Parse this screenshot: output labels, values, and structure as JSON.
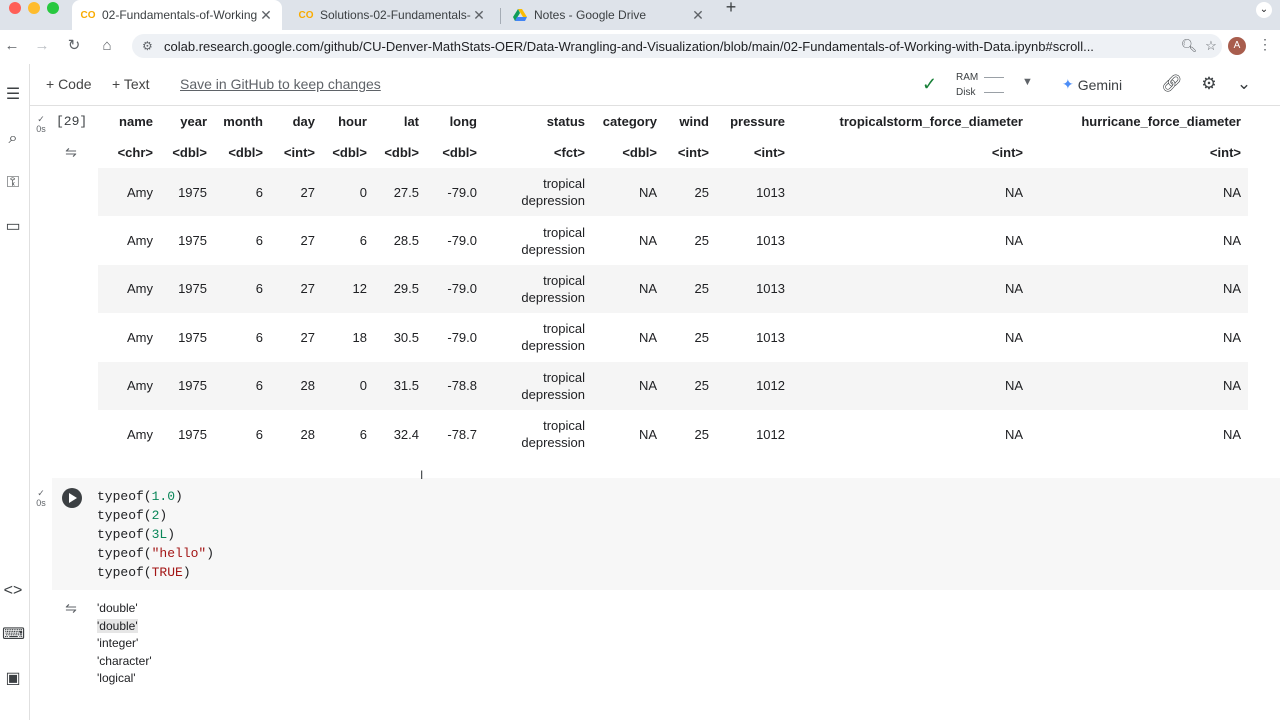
{
  "browser": {
    "tabs": [
      {
        "title": "02-Fundamentals-of-Working",
        "active": true
      },
      {
        "title": "Solutions-02-Fundamentals-",
        "active": false
      },
      {
        "title": "Notes - Google Drive",
        "active": false
      }
    ],
    "new_tab": "+",
    "url": "colab.research.google.com/github/CU-Denver-MathStats-OER/Data-Wrangling-and-Visualization/blob/main/02-Fundamentals-of-Working-with-Data.ipynb#scroll...",
    "avatar_letter": "A"
  },
  "toolbar": {
    "code_label": "+ Code",
    "text_label": "+ Text",
    "save_link": "Save in GitHub to keep changes",
    "ram_label": "RAM",
    "disk_label": "Disk",
    "gemini_label": "Gemini"
  },
  "cells": {
    "table_cell": {
      "status_time": "0s",
      "exec_count": "[29]",
      "columns": [
        "name",
        "year",
        "month",
        "day",
        "hour",
        "lat",
        "long",
        "status",
        "category",
        "wind",
        "pressure",
        "tropicalstorm_force_diameter",
        "hurricane_force_diameter"
      ],
      "types": [
        "<chr>",
        "<dbl>",
        "<dbl>",
        "<int>",
        "<dbl>",
        "<dbl>",
        "<dbl>",
        "<fct>",
        "<dbl>",
        "<int>",
        "<int>",
        "<int>",
        "<int>"
      ],
      "rows": [
        [
          "Amy",
          "1975",
          "6",
          "27",
          "0",
          "27.5",
          "-79.0",
          "tropical depression",
          "NA",
          "25",
          "1013",
          "NA",
          "NA"
        ],
        [
          "Amy",
          "1975",
          "6",
          "27",
          "6",
          "28.5",
          "-79.0",
          "tropical depression",
          "NA",
          "25",
          "1013",
          "NA",
          "NA"
        ],
        [
          "Amy",
          "1975",
          "6",
          "27",
          "12",
          "29.5",
          "-79.0",
          "tropical depression",
          "NA",
          "25",
          "1013",
          "NA",
          "NA"
        ],
        [
          "Amy",
          "1975",
          "6",
          "27",
          "18",
          "30.5",
          "-79.0",
          "tropical depression",
          "NA",
          "25",
          "1013",
          "NA",
          "NA"
        ],
        [
          "Amy",
          "1975",
          "6",
          "28",
          "0",
          "31.5",
          "-78.8",
          "tropical depression",
          "NA",
          "25",
          "1012",
          "NA",
          "NA"
        ],
        [
          "Amy",
          "1975",
          "6",
          "28",
          "6",
          "32.4",
          "-78.7",
          "tropical depression",
          "NA",
          "25",
          "1012",
          "NA",
          "NA"
        ]
      ]
    },
    "code_cell": {
      "status_time": "0s",
      "lines": [
        {
          "fn": "typeof(",
          "arg": "1.0",
          "argClass": "num",
          "end": ")"
        },
        {
          "fn": "typeof(",
          "arg": "2",
          "argClass": "num",
          "end": ")"
        },
        {
          "fn": "typeof(",
          "arg": "3L",
          "argClass": "num",
          "end": ")"
        },
        {
          "fn": "typeof(",
          "arg": "\"hello\"",
          "argClass": "str",
          "end": ")"
        },
        {
          "fn": "typeof(",
          "arg": "TRUE",
          "argClass": "bool",
          "end": ")"
        }
      ],
      "outputs": [
        "'double'",
        "'double'",
        "'integer'",
        "'character'",
        "'logical'"
      ]
    }
  },
  "colors": {
    "tabbar_bg": "#dee3ea",
    "close_red": "#ff5f57",
    "minimize_yellow": "#febc2e",
    "maximize_green": "#28c840",
    "check_green": "#188038",
    "gemini_blue": "#4c8df6"
  }
}
